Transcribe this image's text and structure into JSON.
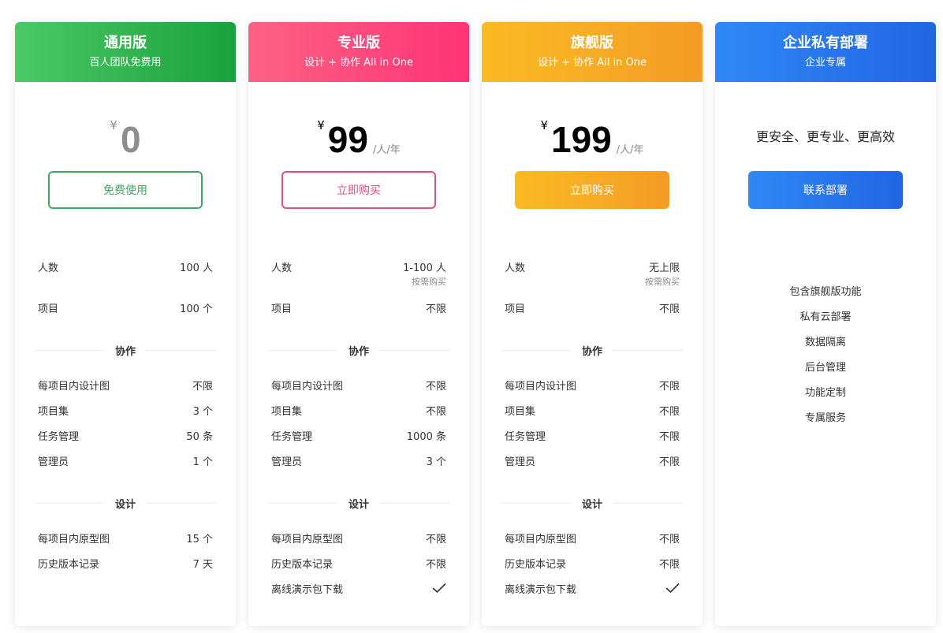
{
  "plans": [
    {
      "name": "通用版",
      "subtitle": "百人团队免费用",
      "currency": "¥",
      "price": "0",
      "unit": "",
      "cta": "免费使用",
      "basic": [
        {
          "label": "人数",
          "value": "100 人",
          "note": ""
        },
        {
          "label": "项目",
          "value": "100 个"
        }
      ],
      "collab_title": "协作",
      "collab": [
        {
          "label": "每项目内设计图",
          "value": "不限"
        },
        {
          "label": "项目集",
          "value": "3 个"
        },
        {
          "label": "任务管理",
          "value": "50 条"
        },
        {
          "label": "管理员",
          "value": "1 个"
        }
      ],
      "design_title": "设计",
      "design": [
        {
          "label": "每项目内原型图",
          "value": "15 个"
        },
        {
          "label": "历史版本记录",
          "value": "7 天"
        }
      ]
    },
    {
      "name": "专业版",
      "subtitle": "设计 + 协作 All in One",
      "currency": "¥",
      "price": "99",
      "unit": "/人/年",
      "cta": "立即购买",
      "basic": [
        {
          "label": "人数",
          "value": "1-100 人",
          "note": "按需购买"
        },
        {
          "label": "项目",
          "value": "不限"
        }
      ],
      "collab_title": "协作",
      "collab": [
        {
          "label": "每项目内设计图",
          "value": "不限"
        },
        {
          "label": "项目集",
          "value": "不限"
        },
        {
          "label": "任务管理",
          "value": "1000 条"
        },
        {
          "label": "管理员",
          "value": "3 个"
        }
      ],
      "design_title": "设计",
      "design": [
        {
          "label": "每项目内原型图",
          "value": "不限"
        },
        {
          "label": "历史版本记录",
          "value": "不限"
        },
        {
          "label": "离线演示包下载",
          "value": "",
          "check": true
        }
      ]
    },
    {
      "name": "旗舰版",
      "subtitle": "设计 + 协作 All in One",
      "currency": "¥",
      "price": "199",
      "unit": "/人/年",
      "cta": "立即购买",
      "basic": [
        {
          "label": "人数",
          "value": "无上限",
          "note": "按需购买"
        },
        {
          "label": "项目",
          "value": "不限"
        }
      ],
      "collab_title": "协作",
      "collab": [
        {
          "label": "每项目内设计图",
          "value": "不限"
        },
        {
          "label": "项目集",
          "value": "不限"
        },
        {
          "label": "任务管理",
          "value": "不限"
        },
        {
          "label": "管理员",
          "value": "不限"
        }
      ],
      "design_title": "设计",
      "design": [
        {
          "label": "每项目内原型图",
          "value": "不限"
        },
        {
          "label": "历史版本记录",
          "value": "不限"
        },
        {
          "label": "离线演示包下载",
          "value": "",
          "check": true
        }
      ]
    },
    {
      "name": "企业私有部署",
      "subtitle": "企业专属",
      "tagline": "更安全、更专业、更高效",
      "cta": "联系部署",
      "features": [
        "包含旗舰版功能",
        "私有云部署",
        "数据隔离",
        "后台管理",
        "功能定制",
        "专属服务"
      ]
    }
  ],
  "colors": {
    "free": "#1aa23d",
    "pro": "#ff3377",
    "flagship": "#f39c26",
    "enterprise": "#2265e4"
  }
}
